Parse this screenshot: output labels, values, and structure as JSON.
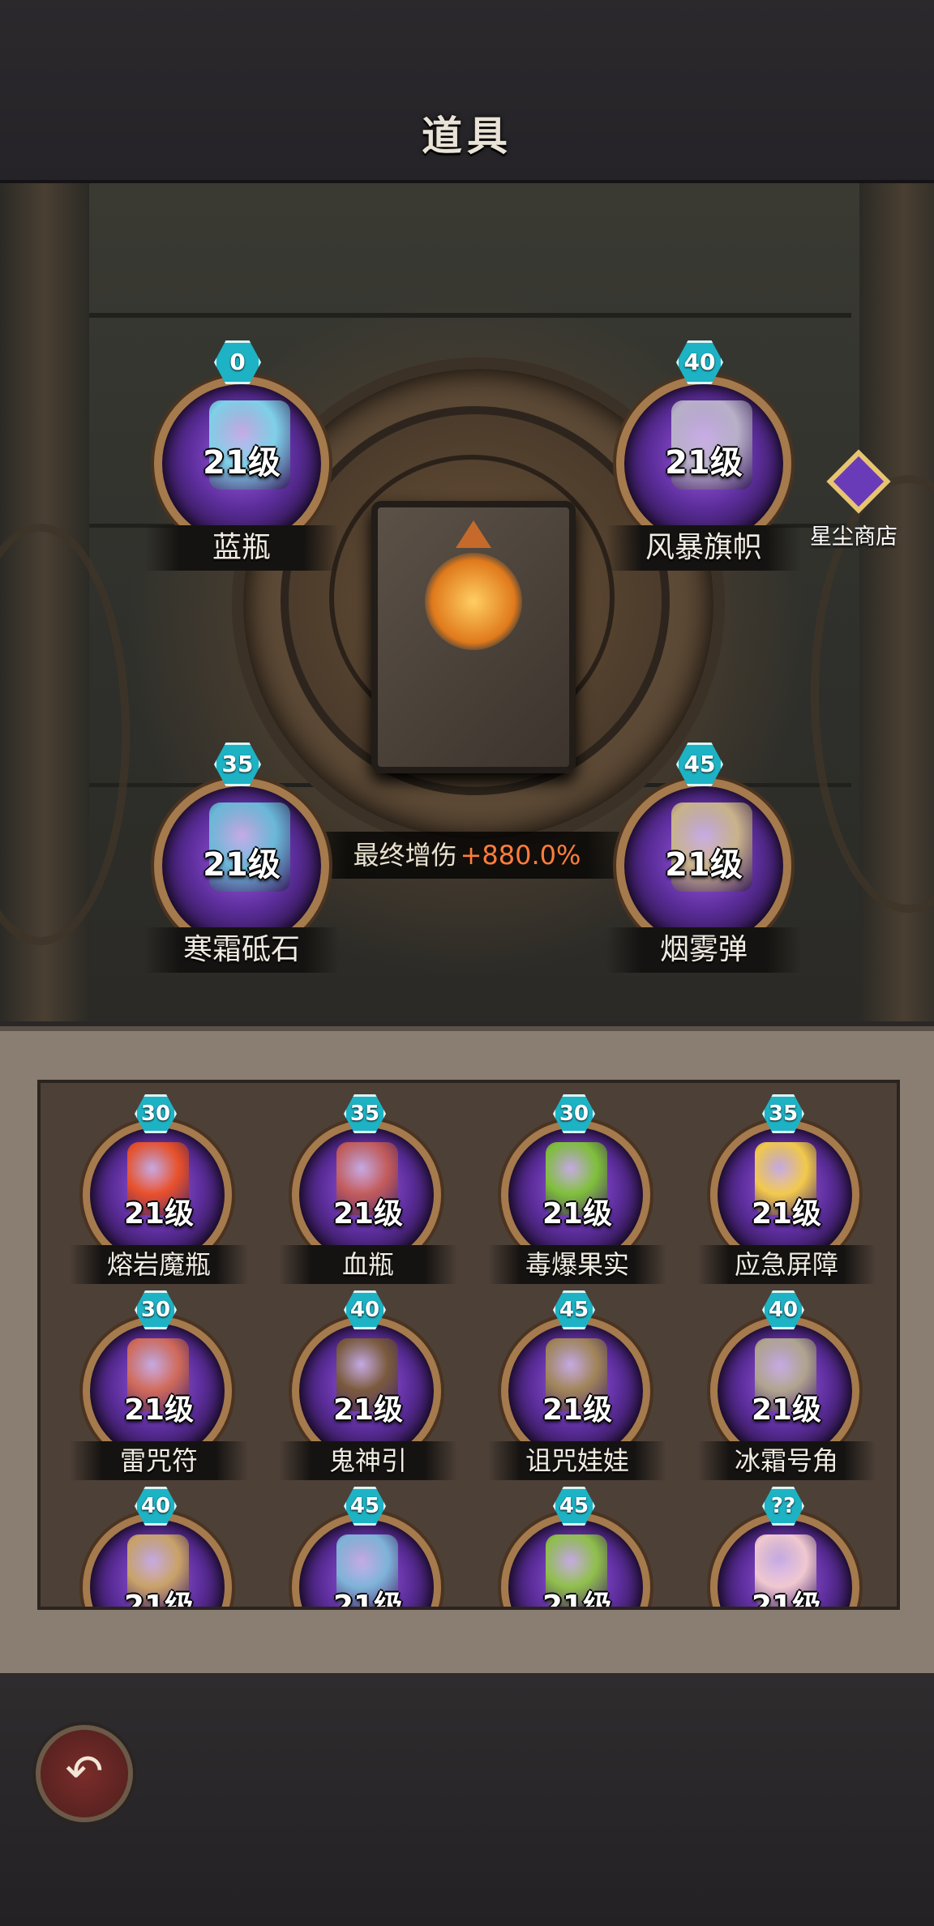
{
  "header": {
    "title": "道具"
  },
  "boost": {
    "label": "最终增伤",
    "value": "+880.0%"
  },
  "shop": {
    "label": "星尘商店",
    "icon": "winged-gem-icon"
  },
  "equipped": [
    {
      "name": "蓝瓶",
      "level": "21级",
      "badge": "0",
      "color": "#7fd0e8"
    },
    {
      "name": "风暴旗帜",
      "level": "21级",
      "badge": "40",
      "color": "#b8b0c8"
    },
    {
      "name": "寒霜砥石",
      "level": "21级",
      "badge": "35",
      "color": "#6ab8d8"
    },
    {
      "name": "烟雾弹",
      "level": "21级",
      "badge": "45",
      "color": "#c9b38a"
    }
  ],
  "inventory": [
    {
      "name": "熔岩魔瓶",
      "level": "21级",
      "badge": "30",
      "color": "#e8502a"
    },
    {
      "name": "血瓶",
      "level": "21级",
      "badge": "35",
      "color": "#c25b5b"
    },
    {
      "name": "毒爆果实",
      "level": "21级",
      "badge": "30",
      "color": "#7fbf3a"
    },
    {
      "name": "应急屏障",
      "level": "21级",
      "badge": "35",
      "color": "#f2c94c"
    },
    {
      "name": "雷咒符",
      "level": "21级",
      "badge": "30",
      "color": "#d06a5a"
    },
    {
      "name": "鬼神引",
      "level": "21级",
      "badge": "40",
      "color": "#7a5a3c"
    },
    {
      "name": "诅咒娃娃",
      "level": "21级",
      "badge": "45",
      "color": "#a08458"
    },
    {
      "name": "冰霜号角",
      "level": "21级",
      "badge": "40",
      "color": "#b0a48e"
    },
    {
      "name": "",
      "level": "21级",
      "badge": "40",
      "color": "#c9a268"
    },
    {
      "name": "",
      "level": "21级",
      "badge": "45",
      "color": "#7fb3d8"
    },
    {
      "name": "",
      "level": "21级",
      "badge": "45",
      "color": "#8fbf4a"
    },
    {
      "name": "",
      "level": "21级",
      "badge": "??",
      "color": "#f0c8d0"
    }
  ],
  "footer": {
    "back_icon": "back-arrow-icon"
  }
}
